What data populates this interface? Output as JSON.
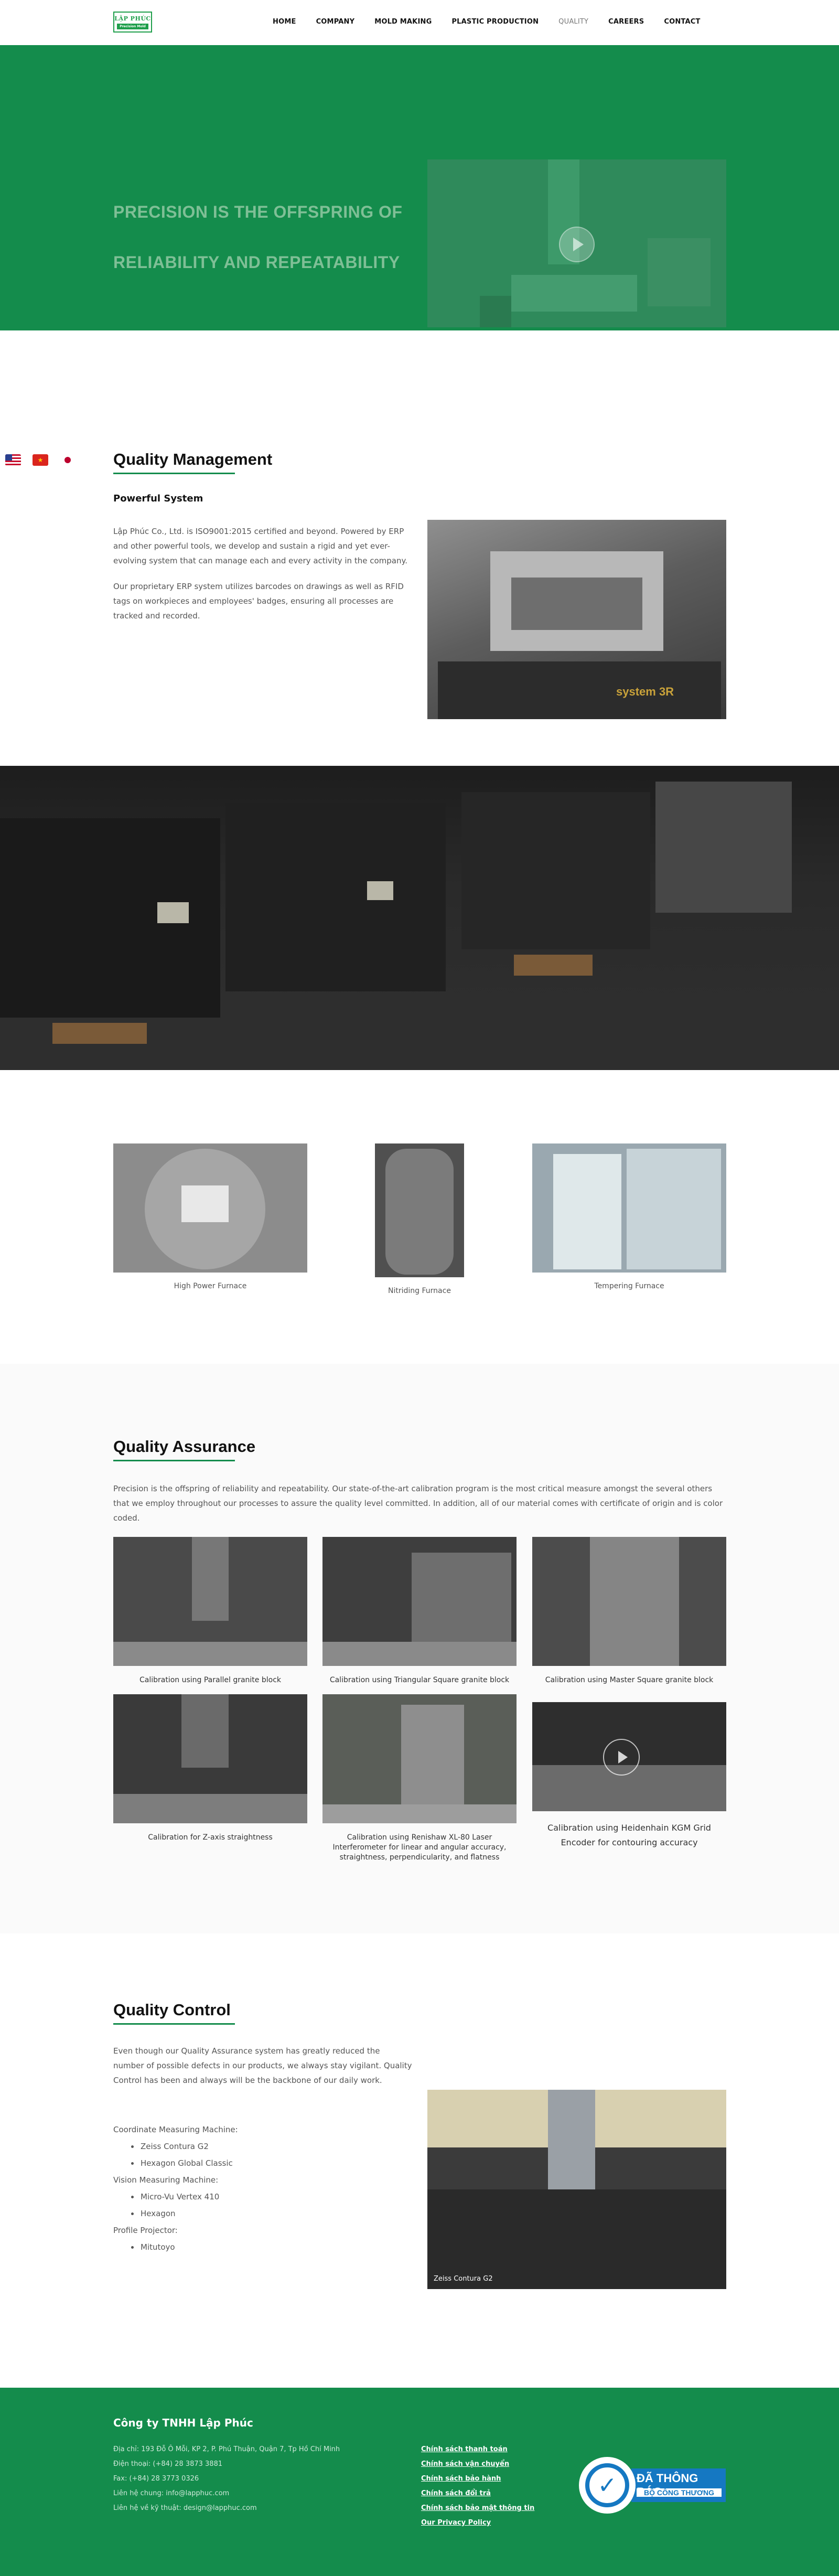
{
  "header": {
    "logo_text": "LẬP PHÚC",
    "logo_subtext": "Precision Mold",
    "nav": [
      {
        "label": "HOME"
      },
      {
        "label": "COMPANY"
      },
      {
        "label": "MOLD MAKING"
      },
      {
        "label": "PLASTIC PRODUCTION"
      },
      {
        "label": "QUALITY",
        "active": true
      },
      {
        "label": "CAREERS"
      },
      {
        "label": "CONTACT"
      }
    ]
  },
  "hero": {
    "line1": "PRECISION IS THE OFFSPRING OF",
    "line2": "RELIABILITY AND REPEATABILITY"
  },
  "flags": [
    "us-flag-icon",
    "vn-flag-icon",
    "jp-flag-icon"
  ],
  "quality_management": {
    "title": "Quality Management",
    "subtitle": "Powerful System",
    "p1": "Lập Phúc Co., Ltd. is ISO9001:2015 certified and beyond. Powered by ERP and other powerful tools, we develop and sustain a rigid and yet ever-evolving system that can manage each and every activity in the company.",
    "p2": "Our proprietary ERP system utilizes barcodes on drawings as well as RFID tags on workpieces and employees' badges, ensuring all processes are tracked and recorded.",
    "image_label": "system 3R"
  },
  "furnaces": [
    {
      "caption": "High Power Furnace"
    },
    {
      "caption": "Nitriding Furnace"
    },
    {
      "caption": "Tempering Furnace"
    }
  ],
  "quality_assurance": {
    "title": "Quality Assurance",
    "intro": "Precision is the offspring of reliability and repeatability. Our state-of-the-art calibration program is the most critical measure amongst the several others that we employ throughout our processes to assure the quality level committed. In addition, all of our material comes with certificate of origin and is color coded.",
    "items": [
      {
        "caption": "Calibration using Parallel granite block"
      },
      {
        "caption": "Calibration using Triangular Square granite block"
      },
      {
        "caption": "Calibration using Master Square granite block"
      },
      {
        "caption": "Calibration for Z-axis straightness"
      },
      {
        "caption": "Calibration using Renishaw XL-80 Laser Interferometer for linear and angular accuracy, straightness, perpendicularity, and flatness"
      },
      {
        "caption": "Calibration using Heidenhain KGM Grid Encoder for contouring accuracy"
      }
    ]
  },
  "quality_control": {
    "title": "Quality Control",
    "intro": "Even though our Quality Assurance system has greatly reduced the number of possible defects in our products, we always stay vigilant. Quality Control has been and always will be the backbone of our daily work.",
    "list": [
      {
        "text": "Coordinate Measuring Machine:",
        "bullet": false
      },
      {
        "text": "Zeiss Contura G2",
        "bullet": true
      },
      {
        "text": "Hexagon Global Classic",
        "bullet": true
      },
      {
        "text": "Vision Measuring Machine:",
        "bullet": false
      },
      {
        "text": "Micro-Vu Vertex 410",
        "bullet": true
      },
      {
        "text": "Hexagon",
        "bullet": true
      },
      {
        "text": "Profile Projector:",
        "bullet": false
      },
      {
        "text": "Mitutoyo",
        "bullet": true
      }
    ],
    "image_caption": "Zeiss Contura G2"
  },
  "footer": {
    "company": "Công ty TNHH Lập Phúc",
    "info": [
      "Địa chỉ: 193 Đỗ Ô Mỗi, KP 2, P. Phú Thuận, Quận 7, Tp Hồ Chí Minh",
      "Điện thoại: (+84) 28 3873 3881",
      "Fax: (+84) 28 3773 0326",
      "Liên hệ chung: info@lapphuc.com",
      "Liên hệ về kỹ thuật: design@lapphuc.com"
    ],
    "links": [
      "Chính sách thanh toán",
      "Chính sách vận chuyển",
      "Chính sách bảo hành",
      "Chính sách đổi trả",
      "Chính sách bảo mật thông tin",
      "Our Privacy Policy"
    ],
    "badge_line1": "ĐÃ THÔNG BÁO",
    "badge_line2": "BỘ CÔNG THƯƠNG"
  }
}
